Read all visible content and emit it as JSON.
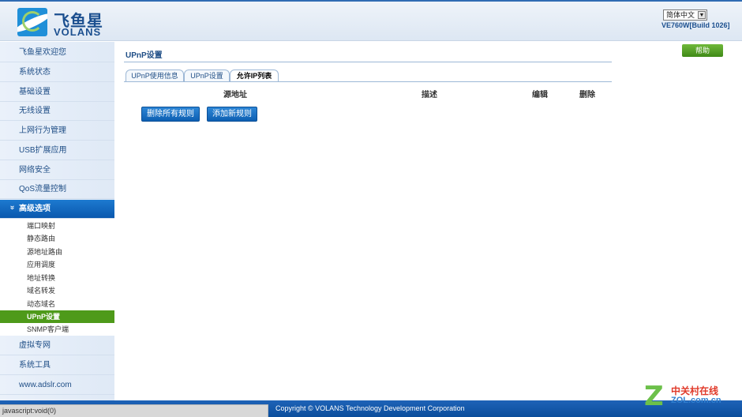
{
  "header": {
    "logo_cn": "飞鱼星",
    "logo_en": "VOLANS",
    "language": "简体中文",
    "build": "VE760W[Build 1026]"
  },
  "sidebar": {
    "items": [
      {
        "label": "飞鱼星欢迎您"
      },
      {
        "label": "系统状态"
      },
      {
        "label": "基础设置"
      },
      {
        "label": "无线设置"
      },
      {
        "label": "上网行为管理"
      },
      {
        "label": "USB扩展应用"
      },
      {
        "label": "网络安全"
      },
      {
        "label": "QoS流量控制"
      },
      {
        "label": "高级选项"
      },
      {
        "label": "虚拟专网"
      },
      {
        "label": "系统工具"
      },
      {
        "label": "www.adslr.com"
      }
    ],
    "expanded_marker": "»",
    "sub_items": [
      {
        "label": "端口映射"
      },
      {
        "label": "静态路由"
      },
      {
        "label": "源地址路由"
      },
      {
        "label": "应用调度"
      },
      {
        "label": "地址转换"
      },
      {
        "label": "域名转发"
      },
      {
        "label": "动态域名"
      },
      {
        "label": "UPnP设置"
      },
      {
        "label": "SNMP客户端"
      }
    ]
  },
  "main": {
    "help_label": "帮助",
    "title": "UPnP设置",
    "tabs": [
      {
        "label": "UPnP使用信息"
      },
      {
        "label": "UPnP设置"
      },
      {
        "label": "允许IP列表"
      }
    ],
    "columns": [
      "源地址",
      "描述",
      "编辑",
      "删除"
    ],
    "buttons": {
      "delete_all": "删除所有规则",
      "add_rule": "添加新规则"
    }
  },
  "footer": {
    "copyright": "Copyright © VOLANS Technology Development Corporation",
    "status_text": "javascript:void(0)"
  },
  "watermark": {
    "letter": "Z",
    "cn": "中关村在线",
    "en": "ZOL.com.cn"
  },
  "colors": {
    "brand_blue": "#1b4f8f",
    "active_menu": "#0a58ae",
    "current_sub": "#4e9a1a",
    "help_green": "#3f8a17"
  }
}
